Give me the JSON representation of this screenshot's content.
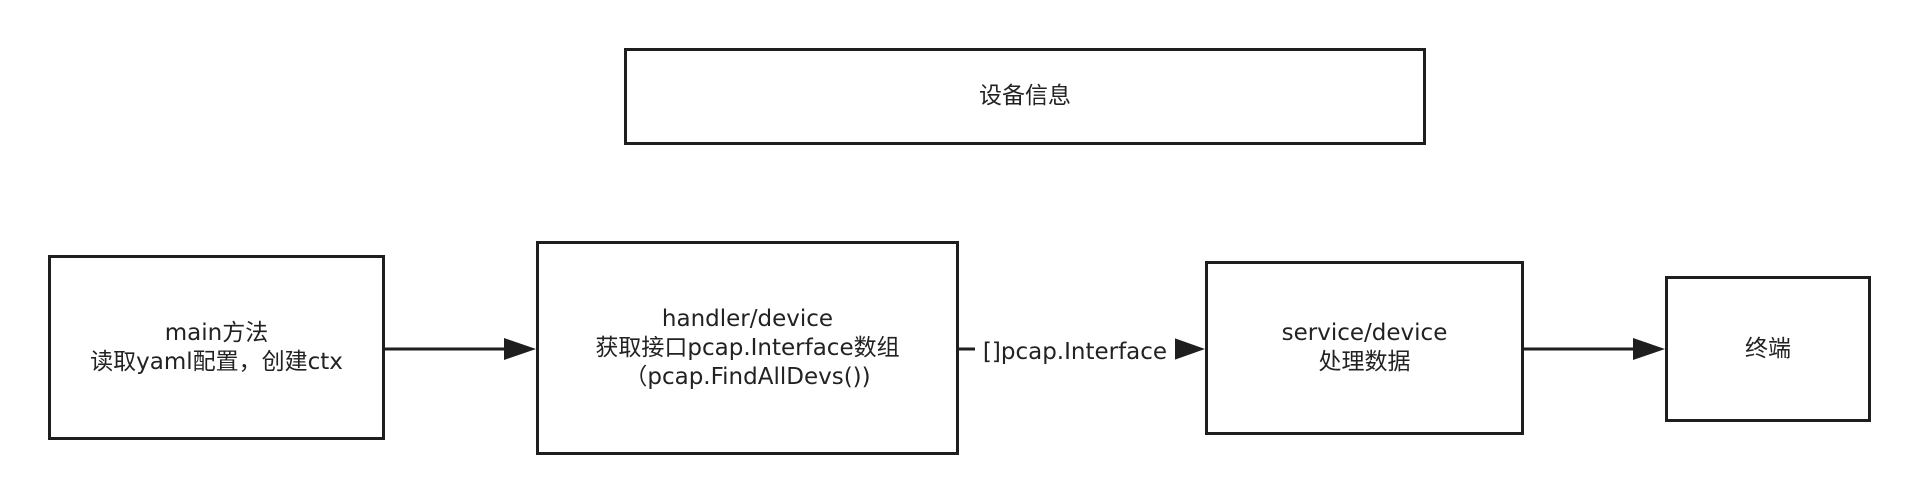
{
  "nodes": {
    "device_info": {
      "label": "设备信息"
    },
    "main": {
      "lines": [
        "main方法",
        "读取yaml配置，创建ctx"
      ]
    },
    "handler": {
      "lines": [
        "handler/device",
        "获取接口pcap.Interface数组",
        "（pcap.FindAllDevs())"
      ]
    },
    "service": {
      "lines": [
        "service/device",
        "处理数据"
      ]
    },
    "terminal": {
      "label": "终端"
    }
  },
  "edges": [
    {
      "from": "main",
      "to": "handler",
      "label": ""
    },
    {
      "from": "handler",
      "to": "service",
      "label": "[]pcap.Interface"
    },
    {
      "from": "service",
      "to": "terminal",
      "label": ""
    }
  ],
  "colors": {
    "stroke": "#1e1e1e",
    "text": "#222222",
    "background": "#ffffff"
  }
}
